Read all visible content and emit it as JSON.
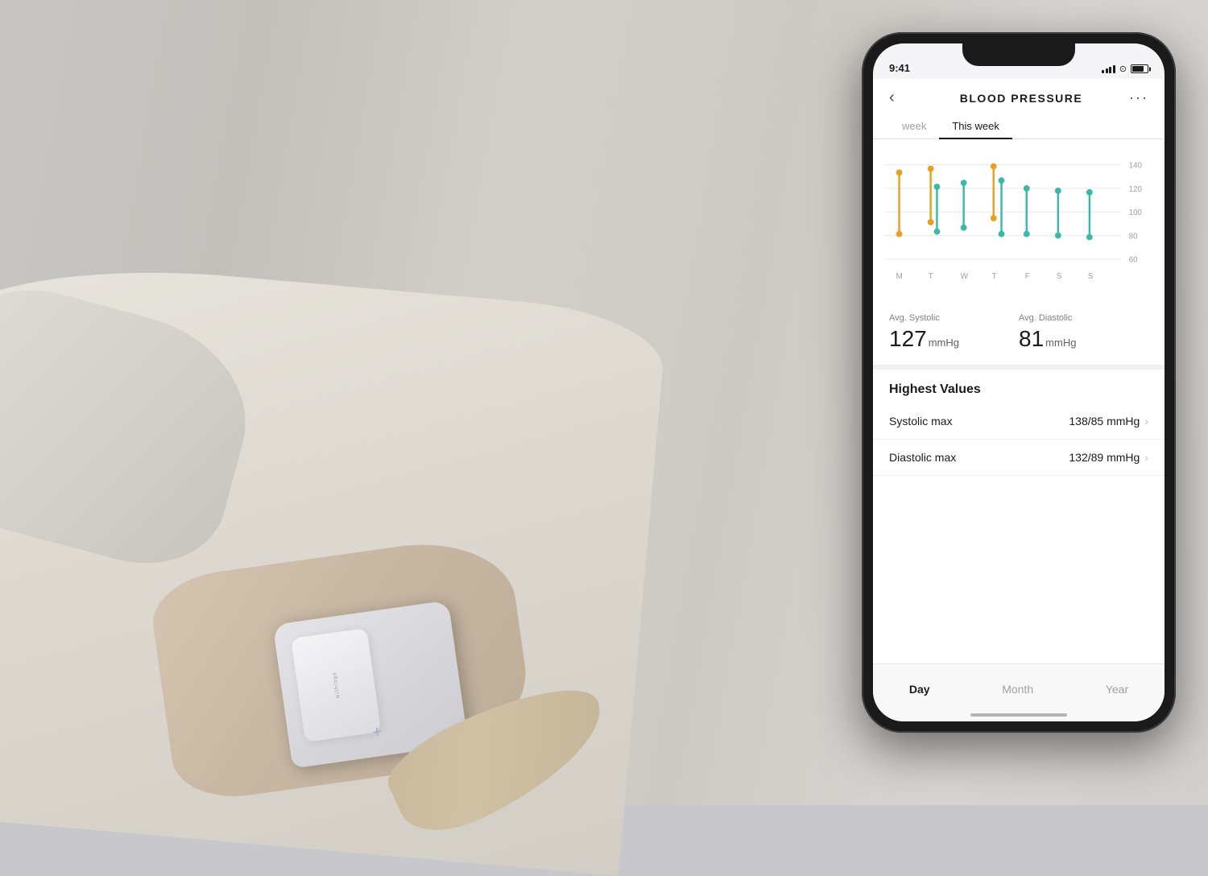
{
  "background": {
    "color": "#c4c2be"
  },
  "phone": {
    "status_bar": {
      "time": "9:41",
      "signal_label": "signal",
      "wifi_label": "wifi",
      "battery_label": "battery"
    },
    "header": {
      "back_label": "‹",
      "title": "BLOOD PRESSURE",
      "more_label": "···"
    },
    "tabs": [
      {
        "label": "week",
        "active": false
      },
      {
        "label": "This week",
        "active": true
      }
    ],
    "chart": {
      "y_labels": [
        "140",
        "120",
        "100",
        "80",
        "60"
      ],
      "x_labels": [
        "M",
        "T",
        "W",
        "T",
        "F",
        "S",
        "S"
      ],
      "systolic_color": "#e8a020",
      "diastolic_color": "#3cb8a8"
    },
    "stats": {
      "systolic_label": "Avg. Systolic",
      "systolic_value": "127",
      "systolic_unit": "mmHg",
      "diastolic_label": "Avg. Diastolic",
      "diastolic_value": "81",
      "diastolic_unit": "mmHg"
    },
    "highest_values": {
      "section_title": "Highest Values",
      "rows": [
        {
          "label": "Systolic max",
          "value": "138/85 mmHg",
          "chevron": "›"
        },
        {
          "label": "Diastolic max",
          "value": "132/89 mmHg",
          "chevron": "›"
        }
      ]
    },
    "bottom_tabs": [
      {
        "label": "Day",
        "active": true
      },
      {
        "label": "Month",
        "active": false
      },
      {
        "label": "Year",
        "active": false
      }
    ]
  },
  "cuff": {
    "brand_text": "withings"
  }
}
